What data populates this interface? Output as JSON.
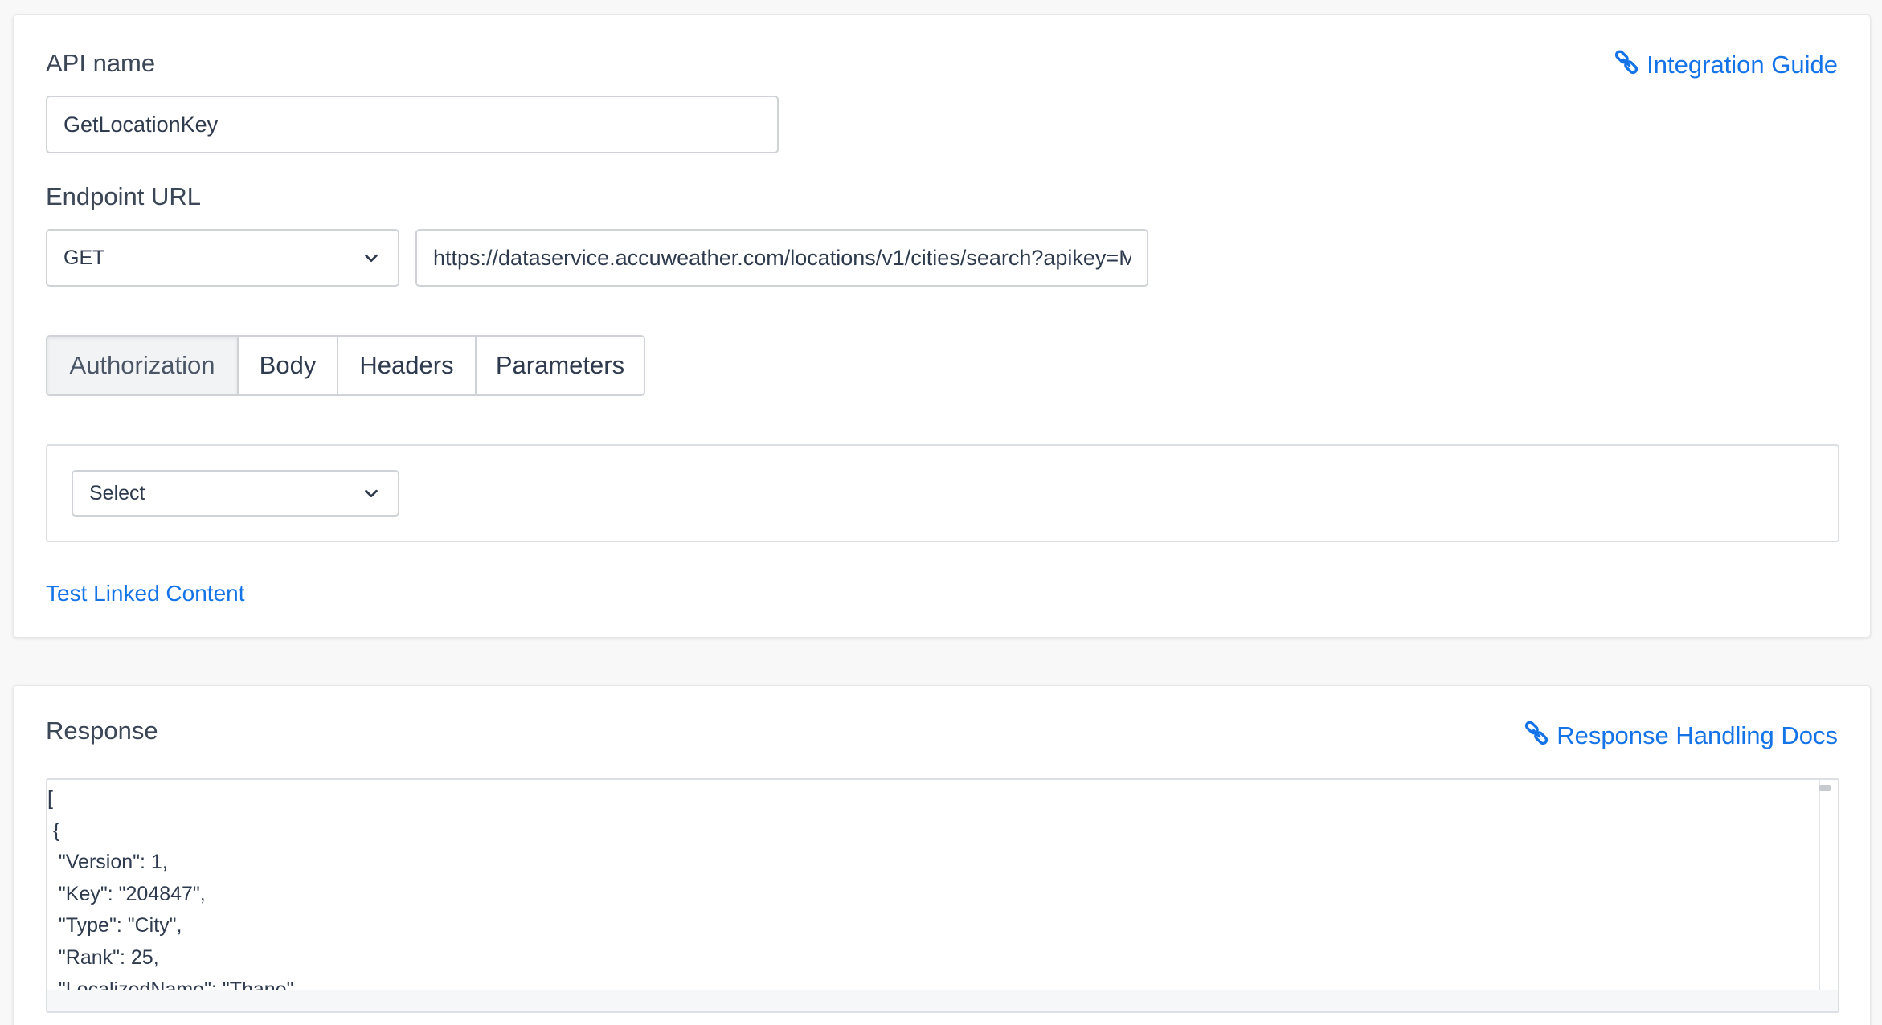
{
  "api": {
    "label": "API name",
    "value": "GetLocationKey"
  },
  "integration_guide": {
    "label": "Integration Guide",
    "icon": "link-icon"
  },
  "endpoint": {
    "label": "Endpoint URL",
    "method": "GET",
    "url": "https://dataservice.accuweather.com/locations/v1/cities/search?apikey=M"
  },
  "tabs": [
    {
      "label": "Authorization",
      "active": true
    },
    {
      "label": "Body",
      "active": false
    },
    {
      "label": "Headers",
      "active": false
    },
    {
      "label": "Parameters",
      "active": false
    }
  ],
  "authorization": {
    "select_value": "Select"
  },
  "test_link": {
    "label": "Test Linked Content"
  },
  "response": {
    "label": "Response",
    "docs_link": "Response Handling Docs",
    "body": "[\n {\n  \"Version\": 1,\n  \"Key\": \"204847\",\n  \"Type\": \"City\",\n  \"Rank\": 25,\n  \"LocalizedName\": \"Thane\","
  },
  "colors": {
    "link": "#1473e6",
    "text": "#2e3a4d",
    "border": "#cfd3d8",
    "page_background": "#f8f8f8"
  }
}
